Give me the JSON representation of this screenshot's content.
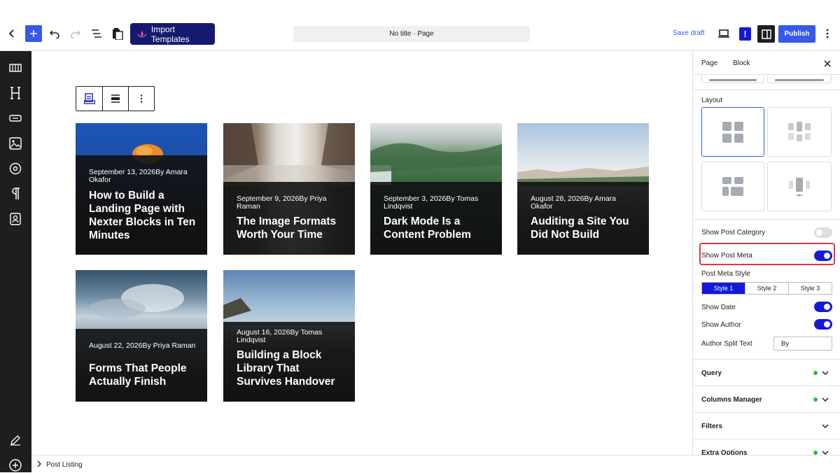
{
  "toolbar": {
    "import_label": "Import Templates",
    "document_title": "No title · Page",
    "save_draft": "Save draft",
    "alert_mark": "!",
    "publish": "Publish"
  },
  "posts": [
    {
      "meta": "September 13, 2026By Amara Okafor",
      "title": "How to Build a Landing Page with Nexter Blocks in Ten Minutes"
    },
    {
      "meta": "September 9, 2026By Priya Raman",
      "title": "The Image Formats Worth Your Time"
    },
    {
      "meta": "September 3, 2026By Tomas Lindqvist",
      "title": "Dark Mode Is a Content Problem"
    },
    {
      "meta": "August 28, 2026By Amara Okafor",
      "title": "Auditing a Site You Did Not Build"
    },
    {
      "meta": "August 22, 2026By Priya Raman",
      "title": "Forms That People Actually Finish"
    },
    {
      "meta": "August 16, 2026By Tomas Lindqvist",
      "title": "Building a Block Library That Survives Handover"
    }
  ],
  "panel": {
    "tabs": [
      "Page",
      "Block"
    ],
    "layout_label": "Layout",
    "show_post_category": {
      "label": "Show Post Category",
      "on": false
    },
    "show_post_meta": {
      "label": "Show Post Meta",
      "on": true
    },
    "post_meta_style": {
      "label": "Post Meta Style",
      "options": [
        "Style 1",
        "Style 2",
        "Style 3"
      ],
      "selected": 0
    },
    "show_date": {
      "label": "Show Date",
      "on": true
    },
    "show_author": {
      "label": "Show Author",
      "on": true
    },
    "author_split": {
      "label": "Author Split Text",
      "value": "By"
    },
    "sections": [
      {
        "label": "Query",
        "dot": true
      },
      {
        "label": "Columns Manager",
        "dot": true
      },
      {
        "label": "Filters",
        "dot": false
      },
      {
        "label": "Extra Options",
        "dot": true
      }
    ]
  },
  "footer": {
    "breadcrumb": "Post Listing"
  },
  "colors": {
    "accent": "#3858e9",
    "brand_dark": "#141a6e",
    "toggle_on": "#141ad6",
    "highlight": "#e5334b",
    "status_dot": "#1ec531"
  }
}
